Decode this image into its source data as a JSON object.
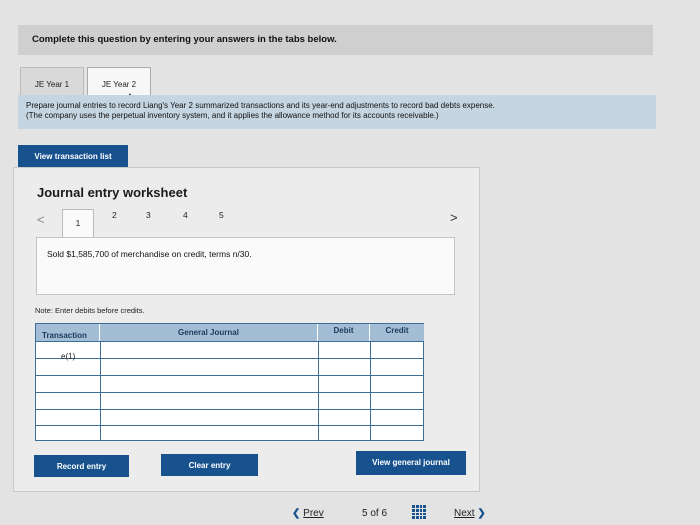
{
  "instructions": "Complete this question by entering your answers in the tabs below.",
  "tabs": [
    {
      "label": "JE Year 1"
    },
    {
      "label": "JE Year 2"
    }
  ],
  "prompt": {
    "line1": "Prepare journal entries to record Liang's Year 2 summarized transactions and its year-end adjustments to record bad debts expense.",
    "line2": "(The company uses the perpetual inventory system, and it applies the allowance method for its accounts receivable.)"
  },
  "view_transaction_list": "View transaction list",
  "worksheet": {
    "title": "Journal entry worksheet",
    "pages": [
      "1",
      "2",
      "3",
      "4",
      "5"
    ],
    "prev_glyph": "<",
    "next_glyph": ">",
    "description": "Sold $1,585,700 of merchandise on credit, terms n/30.",
    "note": "Note: Enter debits before credits."
  },
  "table": {
    "headers": {
      "transaction": "Transaction",
      "general_journal": "General Journal",
      "debit": "Debit",
      "credit": "Credit"
    },
    "transaction_label": "e(1)"
  },
  "buttons": {
    "record": "Record entry",
    "clear": "Clear entry",
    "view_general_journal": "View general journal"
  },
  "pagination": {
    "prev": "Prev",
    "page_of": "5 of 6",
    "next": "Next"
  },
  "colors": {
    "button": "#17528f",
    "prompt_bg": "#c5d5e1",
    "table_header": "#a3bed4"
  }
}
